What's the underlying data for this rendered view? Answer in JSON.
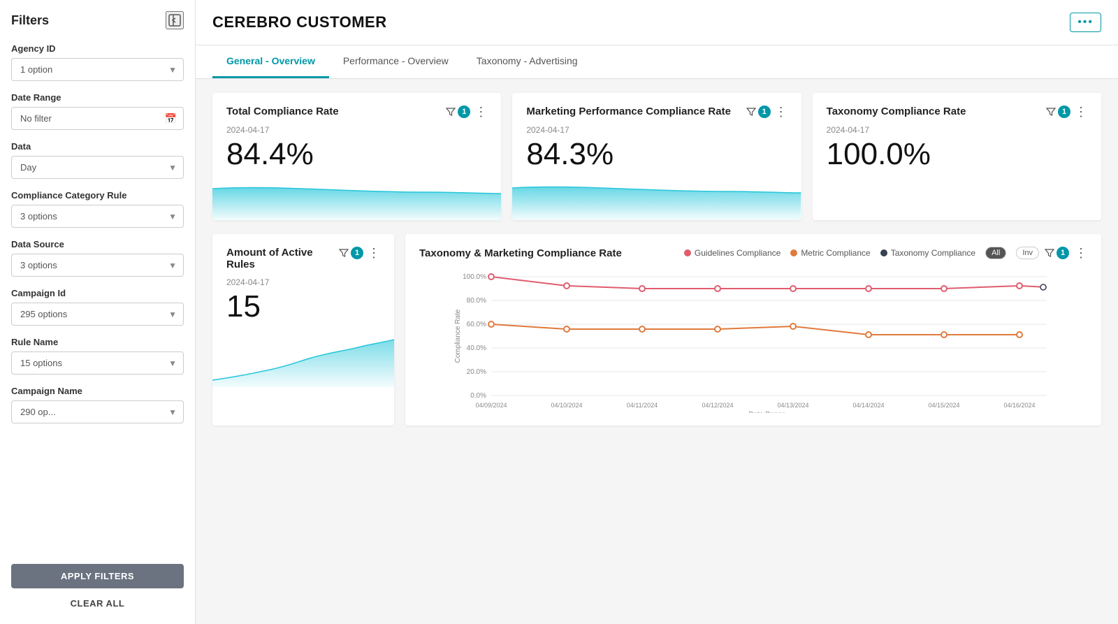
{
  "sidebar": {
    "title": "Filters",
    "collapse_label": "←|",
    "filters": [
      {
        "id": "agency-id",
        "label": "Agency ID",
        "value": "1 option",
        "type": "select"
      },
      {
        "id": "date-range",
        "label": "Date Range",
        "value": "No filter",
        "type": "date"
      },
      {
        "id": "data",
        "label": "Data",
        "value": "Day",
        "type": "select"
      },
      {
        "id": "compliance-category-rule",
        "label": "Compliance Category Rule",
        "value": "3 options",
        "type": "select"
      },
      {
        "id": "data-source",
        "label": "Data Source",
        "value": "3 options",
        "type": "select"
      },
      {
        "id": "campaign-id",
        "label": "Campaign Id",
        "value": "295 options",
        "type": "select"
      },
      {
        "id": "rule-name",
        "label": "Rule Name",
        "value": "15 options",
        "type": "select"
      },
      {
        "id": "campaign-name",
        "label": "Campaign Name",
        "value": "290 op...",
        "type": "select"
      }
    ],
    "apply_label": "APPLY FILTERS",
    "clear_label": "CLEAR ALL"
  },
  "header": {
    "title": "CEREBRO CUSTOMER",
    "menu_dots": "⋯"
  },
  "tabs": [
    {
      "id": "general-overview",
      "label": "General - Overview",
      "active": true
    },
    {
      "id": "performance-overview",
      "label": "Performance - Overview",
      "active": false
    },
    {
      "id": "taxonomy-advertising",
      "label": "Taxonomy - Advertising",
      "active": false
    }
  ],
  "kpi_cards": [
    {
      "id": "total-compliance-rate",
      "title": "Total Compliance Rate",
      "date": "2024-04-17",
      "value": "84.4%",
      "filter_badge": "1"
    },
    {
      "id": "marketing-performance",
      "title": "Marketing Performance Compliance Rate",
      "date": "2024-04-17",
      "value": "84.3%",
      "filter_badge": "1"
    },
    {
      "id": "taxonomy-compliance",
      "title": "Taxonomy Compliance Rate",
      "date": "2024-04-17",
      "value": "100.0%",
      "filter_badge": "1"
    }
  ],
  "bottom_left": {
    "id": "active-rules",
    "title": "Amount of Active Rules",
    "date": "2024-04-17",
    "value": "15",
    "filter_badge": "1"
  },
  "line_chart": {
    "title": "Taxonomy & Marketing Compliance Rate",
    "filter_badge": "1",
    "legend": [
      {
        "label": "Guidelines Compliance",
        "color": "#e05c6e",
        "dot_fill": "#e05c6e"
      },
      {
        "label": "Metric Compliance",
        "color": "#e07a3c",
        "dot_fill": "#e07a3c"
      },
      {
        "label": "Taxonomy Compliance",
        "color": "#374151",
        "dot_fill": "#374151"
      }
    ],
    "toggles": [
      "All",
      "Inv"
    ],
    "y_labels": [
      "100.0%",
      "80.0%",
      "60.0%",
      "40.0%",
      "20.0%",
      "0.0%"
    ],
    "x_labels": [
      "04/09/2024",
      "04/10/2024",
      "04/11/2024",
      "04/12/2024",
      "04/13/2024",
      "04/14/2024",
      "04/15/2024",
      "04/16/2024"
    ],
    "x_axis_label": "Date Range",
    "y_axis_label": "Compliance Rate"
  }
}
